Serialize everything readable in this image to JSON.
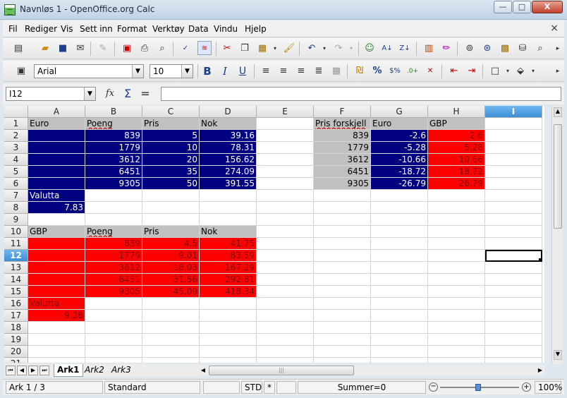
{
  "window": {
    "title": "Navnløs 1 - OpenOffice.org Calc",
    "minimize": "—",
    "maximize": "□",
    "close": "X"
  },
  "menu": [
    "Fil",
    "Rediger",
    "Vis",
    "Sett inn",
    "Format",
    "Verktøy",
    "Data",
    "Vindu",
    "Hjelp"
  ],
  "doc_close": "×",
  "formatting": {
    "font_name": "Arial",
    "font_size": "10"
  },
  "formula_bar": {
    "name_box": "I12",
    "content": ""
  },
  "grid": {
    "columns": [
      "A",
      "B",
      "C",
      "D",
      "E",
      "F",
      "G",
      "H",
      "I"
    ],
    "selected_column": "I",
    "selected_row": "12",
    "rows": [
      "1",
      "2",
      "3",
      "4",
      "5",
      "6",
      "7",
      "8",
      "9",
      "10",
      "11",
      "12",
      "13",
      "14",
      "15",
      "16",
      "17",
      "18",
      "19",
      "20",
      "21"
    ],
    "cells": {
      "A1": "Euro",
      "B1": "Poeng",
      "C1": "Pris",
      "D1": "Nok",
      "F1": "Pris forskjell",
      "G1": "Euro",
      "H1": "GBP",
      "B2": "839",
      "C2": "5",
      "D2": "39.16",
      "F2": "839",
      "G2": "-2.6",
      "H2": "2.6",
      "B3": "1779",
      "C3": "10",
      "D3": "78.31",
      "F3": "1779",
      "G3": "-5.28",
      "H3": "5.28",
      "B4": "3612",
      "C4": "20",
      "D4": "156.62",
      "F4": "3612",
      "G4": "-10.66",
      "H4": "10.66",
      "B5": "6451",
      "C5": "35",
      "D5": "274.09",
      "F5": "6451",
      "G5": "-18.72",
      "H5": "18.72",
      "B6": "9305",
      "C6": "50",
      "D6": "391.55",
      "F6": "9305",
      "G6": "-26.79",
      "H6": "26.79",
      "A7": "Valutta",
      "A8": "7.83",
      "A10": "GBP",
      "B10": "Poeng",
      "C10": "Pris",
      "D10": "Nok",
      "B11": "839",
      "C11": "4.5",
      "D11": "41.75",
      "B12": "1779",
      "C12": "9.01",
      "D12": "83.59",
      "B13": "3612",
      "C13": "18.03",
      "D13": "167.29",
      "B14": "6451",
      "C14": "31.56",
      "D14": "292.81",
      "B15": "9305",
      "C15": "45.09",
      "D15": "418.34",
      "A16": "Valutta",
      "A17": "9.28"
    }
  },
  "sheet_tabs": [
    "Ark1",
    "Ark2",
    "Ark3"
  ],
  "active_tab": "Ark1",
  "status": {
    "sheet": "Ark 1 / 3",
    "style": "Standard",
    "mode": "STD",
    "modified": "*",
    "sum": "Summer=0",
    "zoom": "100%"
  },
  "colors": {
    "navy": "#000080",
    "red": "#ff0000",
    "grey": "#c0c0c0",
    "selection": "#3c8fd6"
  }
}
